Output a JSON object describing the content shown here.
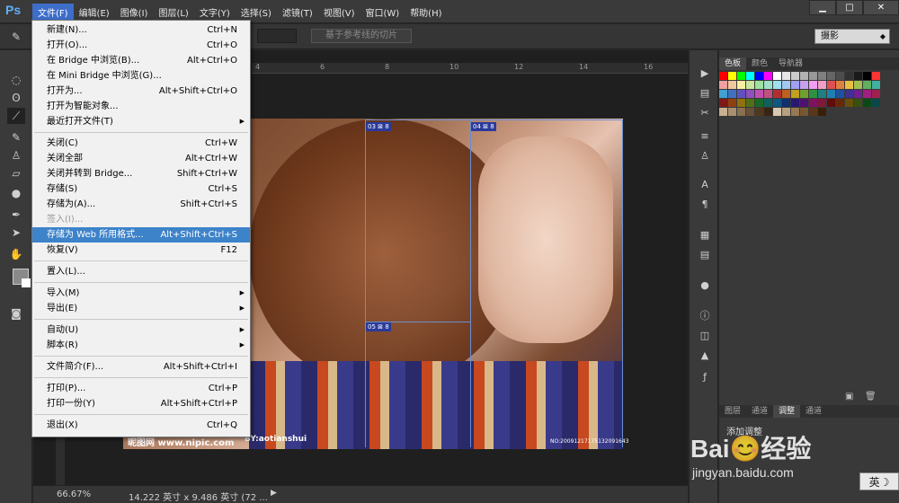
{
  "app": {
    "logo": "Ps"
  },
  "menubar": {
    "items": [
      "文件(F)",
      "编辑(E)",
      "图像(I)",
      "图层(L)",
      "文字(Y)",
      "选择(S)",
      "滤镜(T)",
      "视图(V)",
      "窗口(W)",
      "帮助(H)"
    ],
    "active_index": 0
  },
  "window_controls": {
    "minimize": "▁",
    "restore": "□",
    "close": "✕"
  },
  "options_bar": {
    "slice_button_label": "基于参考线的切片",
    "workspace_value": "摄影"
  },
  "file_menu": [
    {
      "label": "新建(N)...",
      "shortcut": "Ctrl+N"
    },
    {
      "label": "打开(O)...",
      "shortcut": "Ctrl+O"
    },
    {
      "label": "在 Bridge 中浏览(B)...",
      "shortcut": "Alt+Ctrl+O"
    },
    {
      "label": "在 Mini Bridge 中浏览(G)...",
      "shortcut": ""
    },
    {
      "label": "打开为...",
      "shortcut": "Alt+Shift+Ctrl+O"
    },
    {
      "label": "打开为智能对象...",
      "shortcut": ""
    },
    {
      "label": "最近打开文件(T)",
      "shortcut": "",
      "submenu": true
    },
    {
      "label": "关闭(C)",
      "shortcut": "Ctrl+W"
    },
    {
      "label": "关闭全部",
      "shortcut": "Alt+Ctrl+W"
    },
    {
      "label": "关闭并转到 Bridge...",
      "shortcut": "Shift+Ctrl+W"
    },
    {
      "label": "存储(S)",
      "shortcut": "Ctrl+S"
    },
    {
      "label": "存储为(A)...",
      "shortcut": "Shift+Ctrl+S"
    },
    {
      "label": "签入(I)...",
      "shortcut": "",
      "disabled": true
    },
    {
      "label": "存储为 Web 所用格式...",
      "shortcut": "Alt+Shift+Ctrl+S",
      "highlight": true
    },
    {
      "label": "恢复(V)",
      "shortcut": "F12"
    },
    {
      "label": "置入(L)...",
      "shortcut": ""
    },
    {
      "label": "导入(M)",
      "shortcut": "",
      "submenu": true
    },
    {
      "label": "导出(E)",
      "shortcut": "",
      "submenu": true
    },
    {
      "label": "自动(U)",
      "shortcut": "",
      "submenu": true
    },
    {
      "label": "脚本(R)",
      "shortcut": "",
      "submenu": true
    },
    {
      "label": "文件简介(F)...",
      "shortcut": "Alt+Shift+Ctrl+I"
    },
    {
      "label": "打印(P)...",
      "shortcut": "Ctrl+P"
    },
    {
      "label": "打印一份(Y)",
      "shortcut": "Alt+Shift+Ctrl+P"
    },
    {
      "label": "退出(X)",
      "shortcut": "Ctrl+Q"
    }
  ],
  "ruler": {
    "ticks": [
      "4",
      "6",
      "8",
      "10",
      "12",
      "14",
      "16"
    ]
  },
  "slices": [
    "03",
    "04",
    "05"
  ],
  "slice_badge": "⊠ 8",
  "photo_watermark": {
    "site": "昵图网 www.nipic.com",
    "author": "BY:aotianshui",
    "id": "NO:20091217175132091643"
  },
  "status_bar": {
    "zoom": "66.67%",
    "doc_info": "14.222 英寸 x 9.486 英寸 (72 ...",
    "arrow": "▶"
  },
  "right_panel": {
    "top_tabs": [
      "色板",
      "颜色",
      "导航器"
    ],
    "bottom_tabs": [
      "图层",
      "通道",
      "调整",
      "通道"
    ],
    "adjust_label": "添加调整"
  },
  "swatch_colors": [
    "#ff0000",
    "#ffff00",
    "#00ff00",
    "#00ffff",
    "#0000ff",
    "#ff00ff",
    "#ffffff",
    "#e6e6e6",
    "#cccccc",
    "#b3b3b3",
    "#999999",
    "#808080",
    "#666666",
    "#4d4d4d",
    "#333333",
    "#1a1a1a",
    "#000000",
    "#ff3333",
    "#f0a0a0",
    "#f0c8a0",
    "#f8f0a0",
    "#c8e8a0",
    "#a0e0a0",
    "#a0e0c8",
    "#a0e0f0",
    "#a0c8f0",
    "#a0a0f0",
    "#c8a0f0",
    "#f0a0f0",
    "#f0a0c8",
    "#e05050",
    "#e08040",
    "#e8c040",
    "#a0c050",
    "#60b060",
    "#40b0a0",
    "#40a0d0",
    "#4070c0",
    "#6050c0",
    "#9050c0",
    "#c050b0",
    "#c05080",
    "#b03030",
    "#c06020",
    "#c0a020",
    "#70a030",
    "#309040",
    "#208080",
    "#2080b0",
    "#2050a0",
    "#403090",
    "#702090",
    "#a02080",
    "#a02050",
    "#801818",
    "#904010",
    "#907010",
    "#507018",
    "#186828",
    "#106060",
    "#105880",
    "#103070",
    "#281870",
    "#501070",
    "#801060",
    "#801838",
    "#600c0c",
    "#682808",
    "#685008",
    "#385010",
    "#0c4818",
    "#084848",
    "#c8b090",
    "#a89070",
    "#887050",
    "#685038",
    "#503820",
    "#382410",
    "#d8c8b0",
    "#b8a080",
    "#987850",
    "#785830",
    "#583818",
    "#382008"
  ],
  "baidu_watermark": {
    "logo": "Bai😊经验",
    "url": "jingyan.baidu.com"
  },
  "ime": "英☽"
}
